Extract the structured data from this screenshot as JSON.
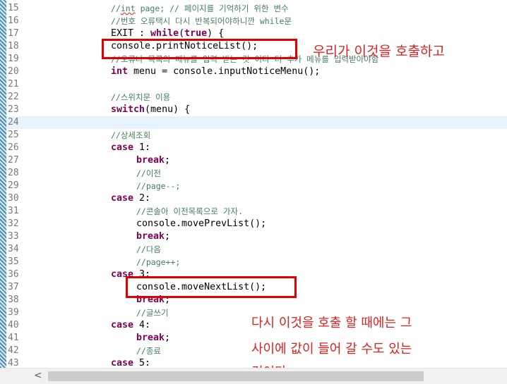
{
  "editor": {
    "lines": [
      {
        "num": "15",
        "indent": 0,
        "parts": [
          [
            "cm",
            "//"
          ],
          [
            "cm sq",
            "int"
          ],
          [
            "cm",
            " page; // 페이지를 기억하기 위한 변수"
          ]
        ]
      },
      {
        "num": "16",
        "indent": 0,
        "parts": [
          [
            "cm",
            "//번호 오류택시 다시 반복되어야하니깐 while문"
          ]
        ]
      },
      {
        "num": "17",
        "indent": 0,
        "parts": [
          [
            "",
            "EXIT : "
          ],
          [
            "kw",
            "while"
          ],
          [
            "",
            "("
          ],
          [
            "kw",
            "true"
          ],
          [
            "",
            ") {"
          ]
        ]
      },
      {
        "num": "18",
        "indent": 0,
        "parts": [
          [
            "",
            "console.printNoticeList();"
          ]
        ]
      },
      {
        "num": "19",
        "indent": 0,
        "parts": [
          [
            "cm",
            "//오류나 목록의 메뉴를 입력 받는 것 이다 더 추가 메뉴를 입력받아야함"
          ]
        ]
      },
      {
        "num": "20",
        "indent": 0,
        "parts": [
          [
            "kw",
            "int"
          ],
          [
            "",
            " menu = console.inputNoticeMenu();"
          ]
        ]
      },
      {
        "num": "21",
        "indent": 0,
        "parts": []
      },
      {
        "num": "22",
        "indent": 0,
        "parts": [
          [
            "cm",
            "//스위치문 이용"
          ]
        ]
      },
      {
        "num": "23",
        "indent": 0,
        "parts": [
          [
            "kw",
            "switch"
          ],
          [
            "",
            "(menu) {"
          ]
        ]
      },
      {
        "num": "24",
        "indent": 0,
        "parts": [],
        "current": true
      },
      {
        "num": "25",
        "indent": 0,
        "parts": [
          [
            "cm",
            "//상세조회"
          ]
        ]
      },
      {
        "num": "26",
        "indent": 0,
        "parts": [
          [
            "kw",
            "case"
          ],
          [
            "",
            " 1:"
          ]
        ]
      },
      {
        "num": "27",
        "indent": 1,
        "parts": [
          [
            "kw",
            "break"
          ],
          [
            "",
            ";"
          ]
        ]
      },
      {
        "num": "28",
        "indent": 1,
        "parts": [
          [
            "cm",
            "//이전"
          ]
        ]
      },
      {
        "num": "29",
        "indent": 1,
        "parts": [
          [
            "cm",
            "//page--;"
          ]
        ]
      },
      {
        "num": "30",
        "indent": 0,
        "parts": [
          [
            "kw",
            "case"
          ],
          [
            "",
            " 2:"
          ]
        ]
      },
      {
        "num": "31",
        "indent": 1,
        "parts": [
          [
            "cm",
            "//콘솔아 이전목록으로 가자."
          ]
        ]
      },
      {
        "num": "32",
        "indent": 1,
        "parts": [
          [
            "",
            "console.movePrevList();"
          ]
        ]
      },
      {
        "num": "33",
        "indent": 1,
        "parts": [
          [
            "kw",
            "break"
          ],
          [
            "",
            ";"
          ]
        ]
      },
      {
        "num": "34",
        "indent": 1,
        "parts": [
          [
            "cm",
            "//다음"
          ]
        ]
      },
      {
        "num": "35",
        "indent": 1,
        "parts": [
          [
            "cm",
            "//page++;"
          ]
        ]
      },
      {
        "num": "36",
        "indent": 0,
        "parts": [
          [
            "kw",
            "case"
          ],
          [
            "",
            " 3:"
          ]
        ]
      },
      {
        "num": "37",
        "indent": 1,
        "parts": [
          [
            "",
            "console.moveNextList();"
          ]
        ]
      },
      {
        "num": "38",
        "indent": 1,
        "parts": [
          [
            "kw",
            "break"
          ],
          [
            "",
            ";"
          ]
        ]
      },
      {
        "num": "39",
        "indent": 1,
        "parts": [
          [
            "cm",
            "//글쓰기"
          ]
        ]
      },
      {
        "num": "40",
        "indent": 0,
        "parts": [
          [
            "kw",
            "case"
          ],
          [
            "",
            " 4:"
          ]
        ]
      },
      {
        "num": "41",
        "indent": 1,
        "parts": [
          [
            "kw",
            "break"
          ],
          [
            "",
            ";"
          ]
        ]
      },
      {
        "num": "42",
        "indent": 1,
        "parts": [
          [
            "cm",
            "//종료"
          ]
        ]
      },
      {
        "num": "43",
        "indent": 0,
        "parts": [
          [
            "kw",
            "case"
          ],
          [
            "",
            " 5:"
          ]
        ]
      }
    ]
  },
  "annotations": {
    "note_top": "우리가 이것을 호출하고",
    "note_bottom_1": "다시 이것을 호출 할 때에는 그",
    "note_bottom_2": "사이에 값이 들어 갈 수도  있는",
    "note_bottom_3": "것이다"
  },
  "scrollbar": {
    "left_arrow": "<"
  },
  "colors": {
    "annotation": "#e00000",
    "comment": "#3f7f5f",
    "keyword": "#7f0055",
    "current_line": "#e8f2fe"
  }
}
